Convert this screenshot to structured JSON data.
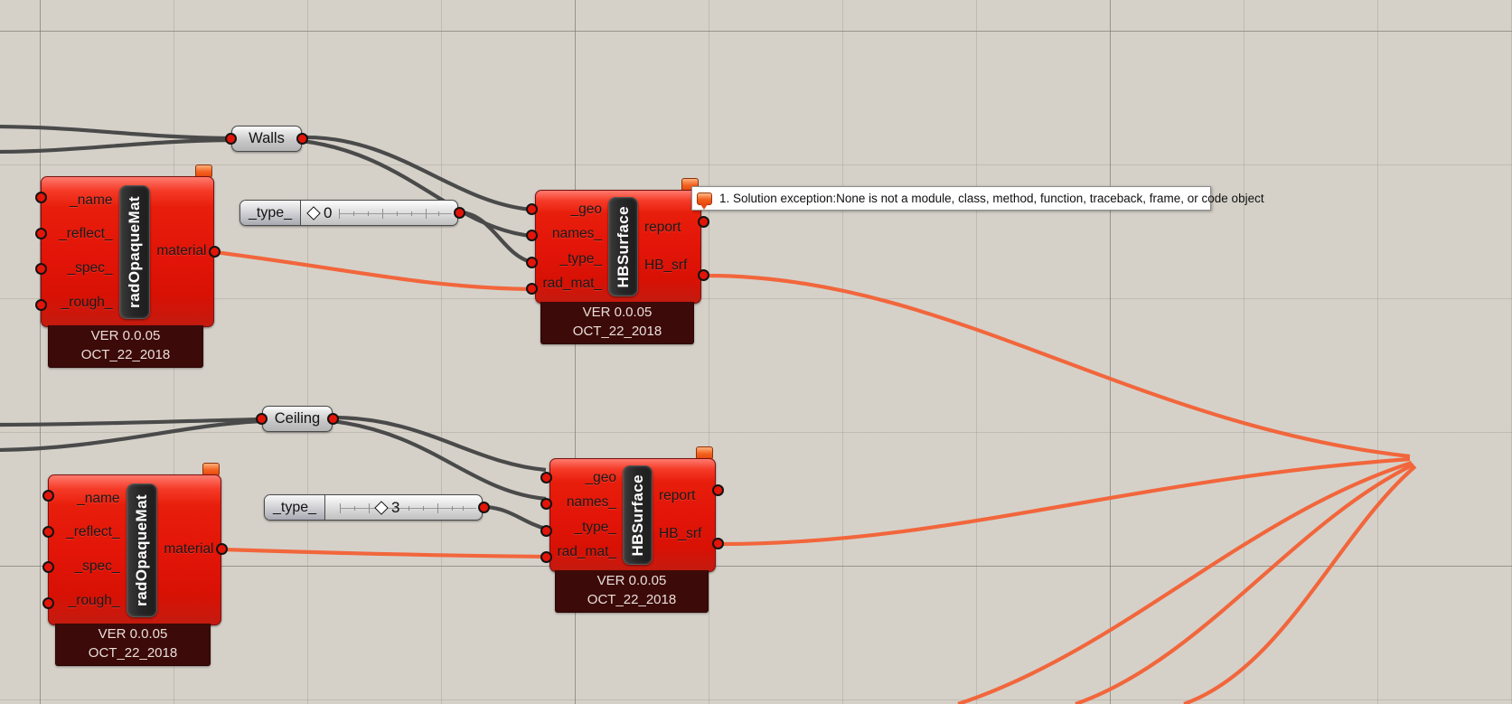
{
  "canvas": {
    "background_color": "#d5d1c9",
    "grid_color": "#96938a"
  },
  "theme": {
    "component_red": "#e21508",
    "wire_grey": "#4a4a4a",
    "wire_orange": "#f2663c",
    "nameplate_dark": "#262626",
    "version_banner_bg": "#3c0a08"
  },
  "components": [
    {
      "id": "rad-opaque-mat-1",
      "name": "radOpaqueMat",
      "inputs": [
        "_name",
        "_reflect_",
        "_spec_",
        "_rough_"
      ],
      "outputs": [
        "material"
      ],
      "version": "VER 0.0.05",
      "date": "OCT_22_2018",
      "has_warning_bubble": true
    },
    {
      "id": "hb-surface-1",
      "name": "HBSurface",
      "inputs": [
        "_geo",
        "names_",
        "_type_",
        "rad_mat_"
      ],
      "outputs": [
        "report",
        "HB_srf"
      ],
      "version": "VER 0.0.05",
      "date": "OCT_22_2018",
      "has_warning_bubble": true
    },
    {
      "id": "rad-opaque-mat-2",
      "name": "radOpaqueMat",
      "inputs": [
        "_name",
        "_reflect_",
        "_spec_",
        "_rough_"
      ],
      "outputs": [
        "material"
      ],
      "version": "VER 0.0.05",
      "date": "OCT_22_2018",
      "has_warning_bubble": true
    },
    {
      "id": "hb-surface-2",
      "name": "HBSurface",
      "inputs": [
        "_geo",
        "names_",
        "_type_",
        "rad_mat_"
      ],
      "outputs": [
        "report",
        "HB_srf"
      ],
      "version": "VER 0.0.05",
      "date": "OCT_22_2018",
      "has_warning_bubble": true
    }
  ],
  "panels": [
    {
      "id": "panel-walls",
      "text": "Walls"
    },
    {
      "id": "panel-ceiling",
      "text": "Ceiling"
    }
  ],
  "sliders": [
    {
      "id": "slider-type-1",
      "label": "_type_",
      "value": "0",
      "handle_percent": 4
    },
    {
      "id": "slider-type-2",
      "label": "_type_",
      "value": "3",
      "handle_percent": 30
    }
  ],
  "tooltip": {
    "text": "1. Solution exception:None is not a module, class, method, function, traceback, frame, or code object",
    "icon": "error-balloon-icon"
  }
}
